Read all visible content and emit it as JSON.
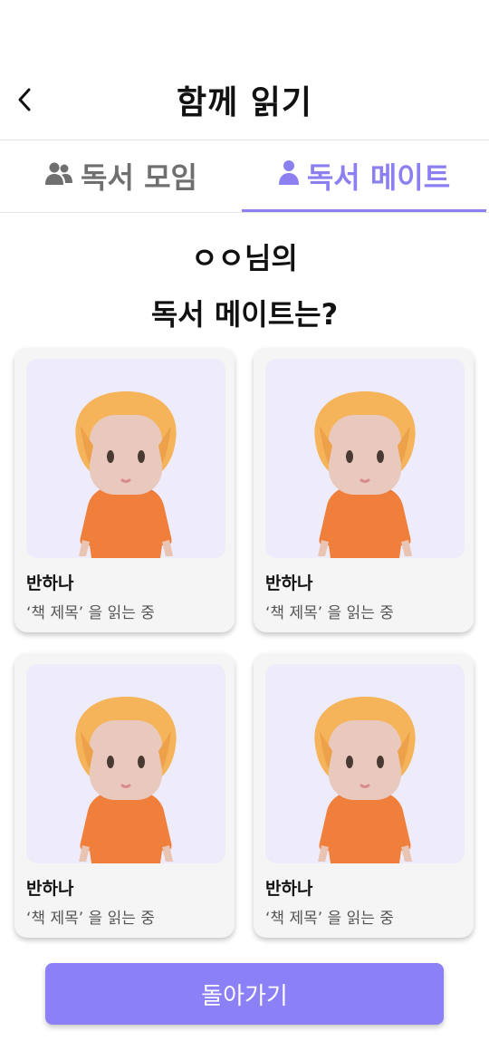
{
  "header": {
    "title": "함께 읽기"
  },
  "tabs": [
    {
      "label": "독서 모임",
      "icon": "group-icon",
      "active": false
    },
    {
      "label": "독서 메이트",
      "icon": "person-icon",
      "active": true
    }
  ],
  "heading": {
    "line1": "ㅇㅇ님의",
    "line2": "독서 메이트는?"
  },
  "mates": [
    {
      "name": "반하나",
      "status": "‘책 제목’ 을 읽는 중"
    },
    {
      "name": "반하나",
      "status": "‘책 제목’ 을 읽는 중"
    },
    {
      "name": "반하나",
      "status": "‘책 제목’ 을 읽는 중"
    },
    {
      "name": "반하나",
      "status": "‘책 제목’ 을 읽는 중"
    }
  ],
  "footer": {
    "back_label": "돌아가기"
  },
  "colors": {
    "accent": "#8c80f0",
    "card_bg": "#f5f5f5",
    "photo_bg": "#eeebfb",
    "shirt": "#f07f3c",
    "hair": "#f5b35a"
  }
}
